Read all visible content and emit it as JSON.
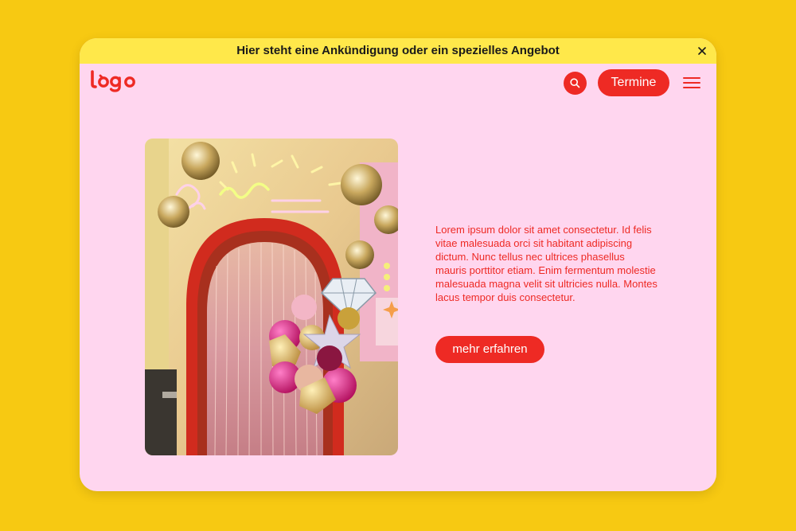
{
  "colors": {
    "background": "#f7c912",
    "card": "#ffd6ef",
    "announcement_bar": "#ffe84a",
    "accent": "#ee2a24",
    "button_text": "#ffffff"
  },
  "announcement": {
    "text": "Hier steht eine Ankündigung oder ein spezielles Angebot",
    "close_icon": "close-icon"
  },
  "header": {
    "logo": "Logo",
    "search_icon": "search-icon",
    "termine_label": "Termine",
    "menu_icon": "hamburger-menu-icon"
  },
  "main": {
    "image_alt": "Party decoration photo with red arch, tinsel curtain, disco balls, balloons and neon signs",
    "body": "Lorem ipsum dolor sit amet consectetur. Id felis vitae malesuada orci sit habitant adipiscing dictum. Nunc tellus nec ultrices phasellus mauris porttitor etiam. Enim fermentum molestie malesuada magna velit sit ultricies nulla. Montes lacus tempor duis consectetur.",
    "cta_label": "mehr erfahren"
  }
}
